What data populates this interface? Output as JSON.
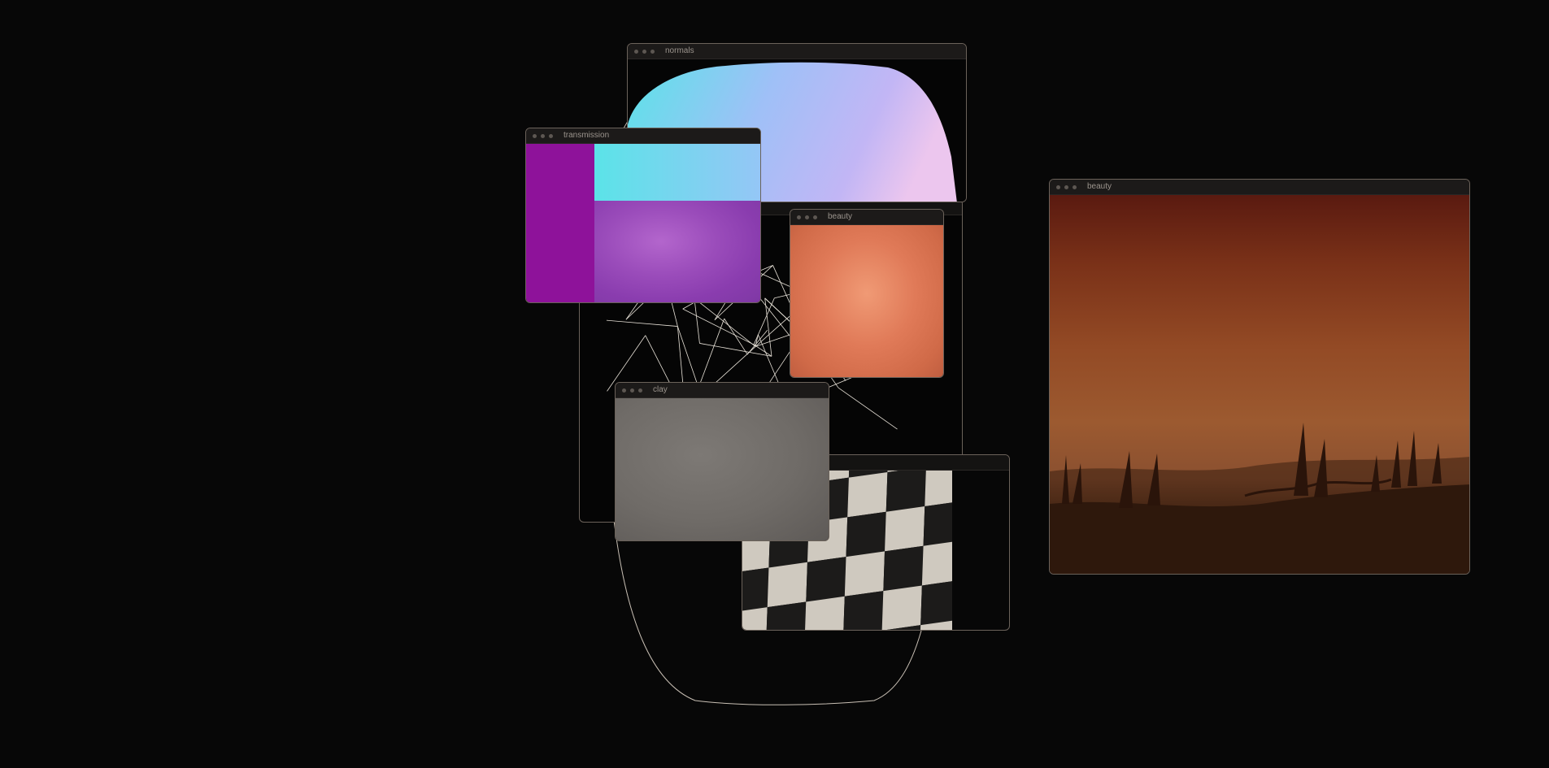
{
  "windows": {
    "normals": {
      "title": "normals"
    },
    "transmission": {
      "title": "transmission"
    },
    "wireframe": {
      "title": ""
    },
    "beauty_small": {
      "title": "beauty"
    },
    "clay": {
      "title": "clay"
    },
    "checker": {
      "title": ""
    },
    "beauty_large": {
      "title": "beauty"
    }
  },
  "colors": {
    "background": "#070707",
    "outline": "#c8bfb4",
    "transmission": "#8e129a",
    "beauty_orange": "#e07a58",
    "clay_gray": "#6f6b67",
    "checker_light": "#cfc9bf",
    "checker_dark": "#1c1b1a",
    "desert_sky_top": "#5a1a10",
    "desert_sky_bottom": "#9c5a30"
  },
  "icons": [
    "window-controls-dots"
  ]
}
